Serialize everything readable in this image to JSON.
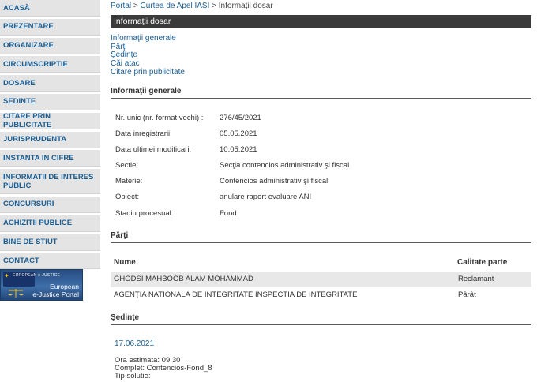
{
  "sidebar": {
    "items": [
      {
        "label": "ACASĂ"
      },
      {
        "label": "PREZENTARE"
      },
      {
        "label": "ORGANIZARE"
      },
      {
        "label": "CIRCUMSCRIPTIE"
      },
      {
        "label": "DOSARE"
      },
      {
        "label": "SEDINTE"
      },
      {
        "label": "CITARE PRIN PUBLICITATE"
      },
      {
        "label": "JURISPRUDENTA"
      },
      {
        "label": "INSTANTA IN CIFRE"
      },
      {
        "label": "INFORMATII DE INTERES PUBLIC"
      },
      {
        "label": "CONCURSURI"
      },
      {
        "label": "ACHIZITII PUBLICE"
      },
      {
        "label": "BINE DE STIUT"
      },
      {
        "label": "CONTACT"
      }
    ],
    "ejustice": {
      "small": "EUROPEAN e-JUSTICE",
      "line1": "European",
      "line2": "e-Justice Portal"
    }
  },
  "breadcrumb": {
    "portal": "Portal",
    "sep": ">",
    "court": "Curtea de Apel IAŞI",
    "current": "Informaţii dosar"
  },
  "title": "Informaţii dosar",
  "toc": [
    "Informaţii generale",
    "Părţi",
    "Şedinţe",
    "Căi atac",
    "Citare prin publicitate"
  ],
  "general": {
    "heading": "Informaţii generale",
    "rows": [
      {
        "label": "Nr. unic (nr. format vechi) :",
        "value": "276/45/2021"
      },
      {
        "label": "Data inregistrarii",
        "value": "05.05.2021"
      },
      {
        "label": "Data ultimei modificari:",
        "value": "10.05.2021"
      },
      {
        "label": "Sectie:",
        "value": "Secţia contencios administrativ şi fiscal"
      },
      {
        "label": "Materie:",
        "value": "Contencios administrativ şi fiscal"
      },
      {
        "label": "Obiect:",
        "value": "anulare raport evaluare ANI"
      },
      {
        "label": "Stadiu procesual:",
        "value": "Fond"
      }
    ]
  },
  "parti": {
    "heading": "Părţi",
    "col_name": "Nume",
    "col_calitate": "Calitate parte",
    "rows": [
      {
        "name": "GHODSI MAHBOOB ALAM MOHAMMAD",
        "calitate": "Reclamant"
      },
      {
        "name": "AGENŢIA NATIONALA DE INTEGRITATE INSPECTIA DE INTEGRITATE",
        "calitate": "Pârât"
      }
    ]
  },
  "sedinte": {
    "heading": "Şedinţe",
    "date": "17.06.2021",
    "ora": "Ora estimata: 09:30",
    "complet": "Complet: Contencios-Fond_8",
    "tip": "Tip solutie:"
  }
}
